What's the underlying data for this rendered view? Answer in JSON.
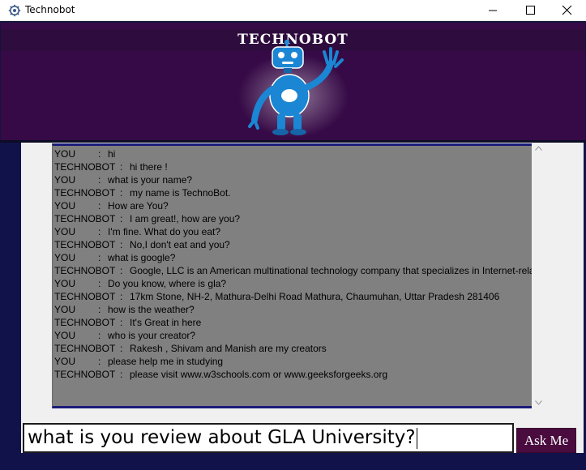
{
  "window": {
    "title": "Technobot",
    "icon": "gear-app-icon",
    "controls": [
      "minimize-icon",
      "maximize-icon",
      "close-icon"
    ]
  },
  "header": {
    "brand": "TECHNOBOT",
    "image": "robot-waving-icon",
    "bg_color": "#360a46"
  },
  "chat": {
    "bg_color": "#808080",
    "lines": [
      {
        "speaker": "YOU",
        "text": "hi"
      },
      {
        "speaker": "TECHNOBOT",
        "text": "hi there !"
      },
      {
        "speaker": "YOU",
        "text": "what is your name?"
      },
      {
        "speaker": "TECHNOBOT",
        "text": "my name is TechnoBot."
      },
      {
        "speaker": "YOU",
        "text": "How are You?"
      },
      {
        "speaker": "TECHNOBOT",
        "text": "I am great!, how are you?"
      },
      {
        "speaker": "YOU",
        "text": "I'm fine. What do you eat?"
      },
      {
        "speaker": "TECHNOBOT",
        "text": "No,I don't eat and you?"
      },
      {
        "speaker": "YOU",
        "text": "what is google?"
      },
      {
        "speaker": "TECHNOBOT",
        "text": "Google, LLC is an American multinational technology company that specializes in Internet-rela"
      },
      {
        "speaker": "YOU",
        "text": "Do you know, where is gla?"
      },
      {
        "speaker": "TECHNOBOT",
        "text": "17km Stone, NH-2, Mathura-Delhi Road Mathura, Chaumuhan, Uttar Pradesh 281406"
      },
      {
        "speaker": "YOU",
        "text": "how is the weather?"
      },
      {
        "speaker": "TECHNOBOT",
        "text": "It's Great in here"
      },
      {
        "speaker": "YOU",
        "text": "who is your creator?"
      },
      {
        "speaker": "TECHNOBOT",
        "text": "Rakesh , Shivam and Manish are my creators"
      },
      {
        "speaker": "YOU",
        "text": "please help me in studying"
      },
      {
        "speaker": "TECHNOBOT",
        "text": "please visit www.w3schools.com or www.geeksforgeeks.org"
      }
    ]
  },
  "input": {
    "value": "what is you review about GLA University?"
  },
  "ask_button": {
    "label": "Ask Me",
    "color": "#4a0b3f"
  }
}
